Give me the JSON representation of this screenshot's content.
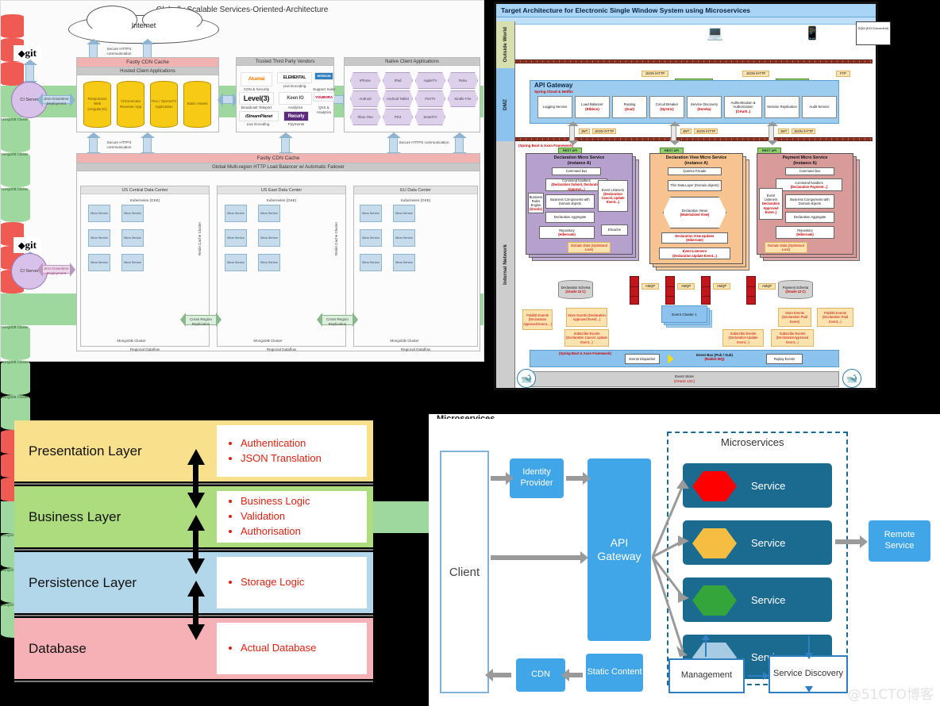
{
  "background_color": "#000000",
  "soa": {
    "title": "Globally Scalable Services-Oriented-Architecture",
    "internet_label": "Internet",
    "git_label": "git",
    "ci_server_label": "CI Server",
    "ci_to_datacenter_label": "Zero Downtime Deployment",
    "https_label": "Secure HTTPS communication",
    "fastly_cdn_cache": "Fastly CDN Cache",
    "hosted_client_applications": "Hosted Client Applications",
    "hosted_apps": [
      "Responsive Web (AngularJS)",
      "Chromecast Receiver App",
      "Tivo / OpenaTV Application",
      "Static Assets"
    ],
    "trusted_third_party_vendors": "Trusted Third Party Vendors",
    "vendors": [
      {
        "name": "Akamai",
        "caption": "CDN & Security"
      },
      {
        "name": "ELEMENTAL",
        "caption": "Live Encoding"
      },
      {
        "name": "INTERCOM",
        "caption": "Support Suite"
      },
      {
        "name": "Level(3)",
        "caption": "Broadcast Teleport"
      },
      {
        "name": "Keen IO",
        "caption": "Analytics"
      },
      {
        "name": "YOUBORA",
        "caption": "QoS & Analytics"
      },
      {
        "name": "iStreamPlanet",
        "caption": "Live Encoding"
      },
      {
        "name": "Recurly",
        "caption": "Payments"
      }
    ],
    "native_client_applications": "Native Client Applications",
    "native_clients": [
      "iPhone",
      "iPad",
      "AppleTV",
      "Roku",
      "Android",
      "Android Tablet",
      "FireTV",
      "Kindle Fire",
      "Xbox One",
      "PS4",
      "SmartTV"
    ],
    "load_balancer": "Global Multi-region HTTP Load Balancer w/ Automatic Failover",
    "datacenters": [
      {
        "name": "US Central Data Center",
        "k8s": "Kubernetes (GKE)",
        "footer": "Regional Dataflow",
        "mongo_footer": "MongoDB Cluster"
      },
      {
        "name": "US East Data Center",
        "k8s": "Kubernetes (GKE)",
        "footer": "Regional Dataflow",
        "mongo_footer": "MongoDB Cluster"
      },
      {
        "name": "EU Data Center",
        "k8s": "Kubernetes (GKE)",
        "footer": "Regional Dataflow",
        "mongo_footer": "MongoDB Cluster"
      }
    ],
    "micro_service_label": "Micro Service",
    "redis_label": "Redis Cache Cluster",
    "mongo_label": "MongoDB Cluster",
    "cross_region_replication": "Cross Region Replication"
  },
  "target": {
    "title": "Target Architecture for Electronic Single Window System using Microservices",
    "zones": [
      "Outside World",
      "DMZ",
      "Internal Network"
    ],
    "doc_node": "SQM (EDI Document)",
    "protocols": [
      "JSON /HTTP",
      "JSON /HTTP",
      "FTP"
    ],
    "rest_api_proxy": "REST API Proxy",
    "rest_api_adapter": "REST API Adapter",
    "api_gateway": {
      "title": "API Gateway",
      "subtitle": "Spring Cloud & Netflix"
    },
    "gateway_items": [
      {
        "label": "Logging Service",
        "tech": ""
      },
      {
        "label": "Load Balancer",
        "tech": "(Ribbon)"
      },
      {
        "label": "Routing",
        "tech": "(Zuul)"
      },
      {
        "label": "Circuit Breaker",
        "tech": "(Hystrix)"
      },
      {
        "label": "Service Discovery",
        "tech": "(Eureka)"
      },
      {
        "label": "Authentication & Authorization",
        "tech": "(OAuth..)"
      },
      {
        "label": "Session Replication",
        "tech": ""
      },
      {
        "label": "Audit Service",
        "tech": ""
      }
    ],
    "jwt_label": "JWT",
    "json_http_label": "JSON /HTTP",
    "rest_api_label": "REST API",
    "framework_note": "(Spring Boot & Axon Framework)",
    "services": [
      {
        "title": "Declaration Micro Service",
        "instance": "(instance A)",
        "items": [
          "Command bus",
          "Command handlers",
          "Business Components with Domain objects",
          "Declaration Aggregate",
          "Repository",
          "Event Listeners",
          "Ehcache",
          "Business Rules Engine"
        ],
        "red_items": [
          "(Declaration Submit, Declaration Approve...)",
          "(Declaration Cancel, update Event...)",
          "(Hibernate)",
          "(Drools)"
        ],
        "domain_data": "Domain Data (Optimised Lock)"
      },
      {
        "title": "Declaration View Micro Service",
        "instance": "(instance A)",
        "items": [
          "Queries Facade",
          "Thin Data Layer (Domain objects)",
          "Declaration Views",
          "Declaration View Updater",
          "Event Listeners"
        ],
        "red_items": [
          "(Materialized View)",
          "(Hibernate)",
          "(Declaration Update Event...)"
        ]
      },
      {
        "title": "Payment Micro Service",
        "instance": "(instance A)",
        "items": [
          "Command bus",
          "Command handlers",
          "Business Components with Domain objects",
          "Declaration Aggregate",
          "Repository",
          "Event Listeners"
        ],
        "red_items": [
          "(Declaration Payment...)",
          "(Hibernate)",
          "Declaration Approved Event..)"
        ],
        "domain_data": "Domain Data (Optimised Lock)"
      }
    ],
    "schemas": [
      {
        "name": "Declaration Schema",
        "tech": "(Oracle 12 C)"
      },
      {
        "name": "Payment Schema",
        "tech": "(Oracle 12 C)"
      }
    ],
    "amqp_label": "AMQP",
    "event_cluster": "Event Cluster 1",
    "notes": [
      "Publish Events (Declaration Approved Event,...)",
      "Store Events (Declaration Approved Event,..)",
      "Subscribe Events (Declaration Cancel, update Event,..)",
      "Subscribe Events (Declaration Update Event,..)",
      "Store Events (Declaration Paid Event)",
      "Subscribe Events (DeclarationApproved Event,..)",
      "Publish Events (Declaration Paid Event,..)"
    ],
    "event_bus_band": {
      "framework": "(Spring Boot & Axon Framework)",
      "dispatcher": "Events Dispatcher",
      "bus": "Event Bus (Pub / Sub)",
      "bus_tech": "(Rabbit MQ)",
      "replay": "Replay Events"
    },
    "event_store": {
      "name": "Event Store",
      "tech": "(Oracle 12C)"
    },
    "docker_label": "docker"
  },
  "layers": {
    "rows": [
      {
        "name": "Presentation Layer",
        "color": "#f9e08c",
        "bullets": [
          "Authentication",
          "JSON Translation"
        ]
      },
      {
        "name": "Business Layer",
        "color": "#addc7f",
        "bullets": [
          "Business Logic",
          "Validation",
          "Authorisation"
        ]
      },
      {
        "name": "Persistence Layer",
        "color": "#b3d7ea",
        "bullets": [
          "Storage Logic"
        ]
      },
      {
        "name": "Database",
        "color": "#f6b1b6",
        "bullets": [
          "Actual Database"
        ]
      }
    ],
    "bullet_color": "#dd2222"
  },
  "microservices": {
    "cut_title": "Microservices",
    "client": "Client",
    "identity_provider": "Identity Provider",
    "api_gateway": "API Gateway",
    "group_label": "Microservices",
    "services": [
      {
        "label": "Service",
        "hex_color": "#fe0000"
      },
      {
        "label": "Service",
        "hex_color": "#f5bd42"
      },
      {
        "label": "Service",
        "hex_color": "#33a53a"
      },
      {
        "label": "Service",
        "hex_color": "#a8cbe4"
      }
    ],
    "remote_service": "Remote Service",
    "cdn": "CDN",
    "static_content": "Static Content",
    "management": "Management",
    "service_discovery": "Service Discovery",
    "watermark": "@51CTO博客",
    "accent_blue": "#41a6e8",
    "dark_blue": "#1b6b91"
  }
}
